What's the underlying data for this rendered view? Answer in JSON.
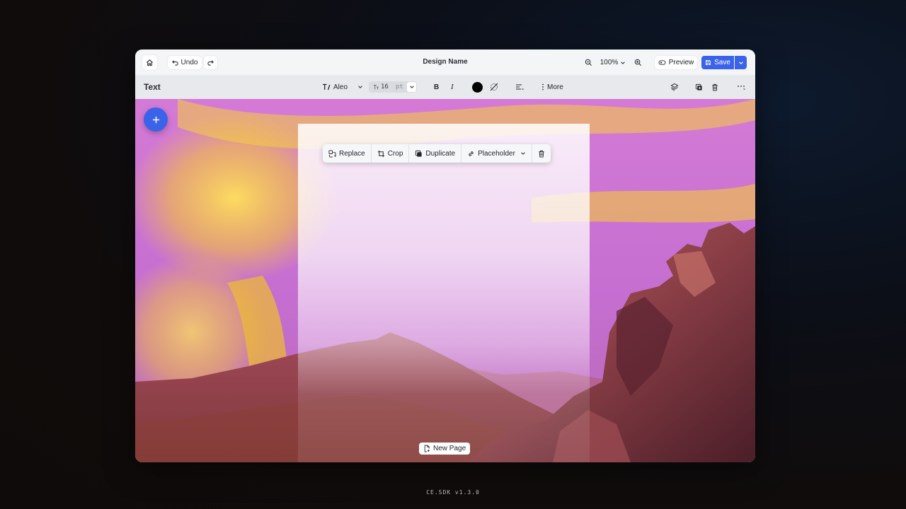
{
  "topbar": {
    "undo_label": "Undo",
    "design_name": "Design Name",
    "zoom_value": "100%",
    "preview_label": "Preview",
    "save_label": "Save"
  },
  "toolbar": {
    "panel_title": "Text",
    "font_name": "Aleo",
    "font_size": "16",
    "font_unit": "pt",
    "bold_label": "B",
    "italic_label": "I",
    "text_color": "#000000",
    "more_label": "More"
  },
  "context_menu": {
    "replace": "Replace",
    "crop": "Crop",
    "duplicate": "Duplicate",
    "placeholder": "Placeholder"
  },
  "canvas": {
    "new_page_label": "New Page"
  },
  "footer": {
    "version": "CE.SDK v1.3.0"
  },
  "colors": {
    "accent": "#3b63ea",
    "background": "#0f0b0a"
  }
}
